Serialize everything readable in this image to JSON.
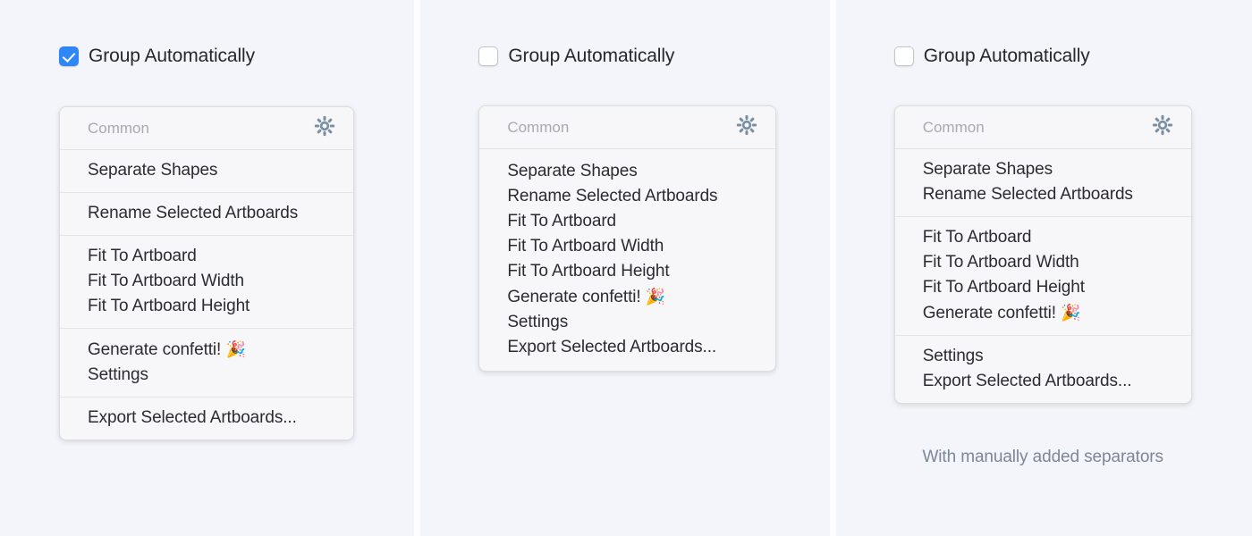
{
  "background_color": "#f4f5fa",
  "accent_color": "#2f87f6",
  "gear_color": "#7b8fa3",
  "panels": [
    {
      "id": "panel-auto-grouped",
      "checkbox": {
        "label": "Group Automatically",
        "checked": true
      },
      "card": {
        "header_title": "Common",
        "gear_icon": "gear-icon",
        "groups": [
          {
            "items": [
              {
                "label": "Separate Shapes"
              }
            ]
          },
          {
            "items": [
              {
                "label": "Rename Selected Artboards"
              }
            ]
          },
          {
            "items": [
              {
                "label": "Fit To Artboard"
              },
              {
                "label": "Fit To Artboard Width"
              },
              {
                "label": "Fit To Artboard Height"
              }
            ]
          },
          {
            "items": [
              {
                "label": "Generate confetti!",
                "emoji": "🎉"
              },
              {
                "label": "Settings"
              }
            ]
          },
          {
            "items": [
              {
                "label": "Export Selected Artboards..."
              }
            ]
          }
        ]
      },
      "caption": ""
    },
    {
      "id": "panel-no-separators",
      "checkbox": {
        "label": "Group Automatically",
        "checked": false
      },
      "card": {
        "header_title": "Common",
        "gear_icon": "gear-icon",
        "groups": [
          {
            "items": [
              {
                "label": "Separate Shapes"
              },
              {
                "label": "Rename Selected Artboards"
              },
              {
                "label": "Fit To Artboard"
              },
              {
                "label": "Fit To Artboard Width"
              },
              {
                "label": "Fit To Artboard Height"
              },
              {
                "label": "Generate confetti!",
                "emoji": "🎉"
              },
              {
                "label": "Settings"
              },
              {
                "label": "Export Selected Artboards..."
              }
            ]
          }
        ]
      },
      "caption": ""
    },
    {
      "id": "panel-manual-separators",
      "checkbox": {
        "label": "Group Automatically",
        "checked": false
      },
      "card": {
        "header_title": "Common",
        "gear_icon": "gear-icon",
        "groups": [
          {
            "items": [
              {
                "label": "Separate Shapes"
              },
              {
                "label": "Rename Selected Artboards"
              }
            ]
          },
          {
            "items": [
              {
                "label": "Fit To Artboard"
              },
              {
                "label": "Fit To Artboard Width"
              },
              {
                "label": "Fit To Artboard Height"
              },
              {
                "label": "Generate confetti!",
                "emoji": "🎉"
              }
            ]
          },
          {
            "items": [
              {
                "label": "Settings"
              },
              {
                "label": "Export Selected Artboards..."
              }
            ]
          }
        ]
      },
      "caption": "With manually added separators"
    }
  ]
}
